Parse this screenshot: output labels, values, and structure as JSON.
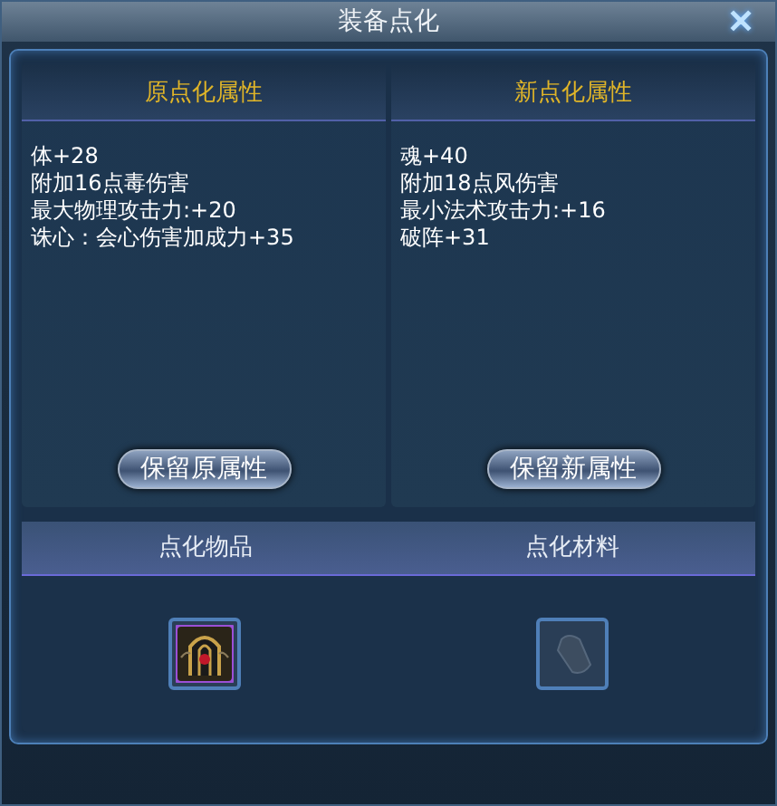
{
  "window": {
    "title": "装备点化",
    "close": "✕"
  },
  "attribute_panels": [
    {
      "heading": "原点化属性",
      "lines": [
        "体+28",
        "附加16点毒伤害",
        "最大物理攻击力:+20",
        "诛心：会心伤害加成力+35"
      ],
      "button": "保留原属性"
    },
    {
      "heading": "新点化属性",
      "lines": [
        "魂+40",
        "附加18点风伤害",
        "最小法术攻击力:+16",
        "破阵+31"
      ],
      "button": "保留新属性"
    }
  ],
  "slots": [
    {
      "label": "点化物品",
      "kind": "item"
    },
    {
      "label": "点化材料",
      "kind": "empty"
    }
  ]
}
